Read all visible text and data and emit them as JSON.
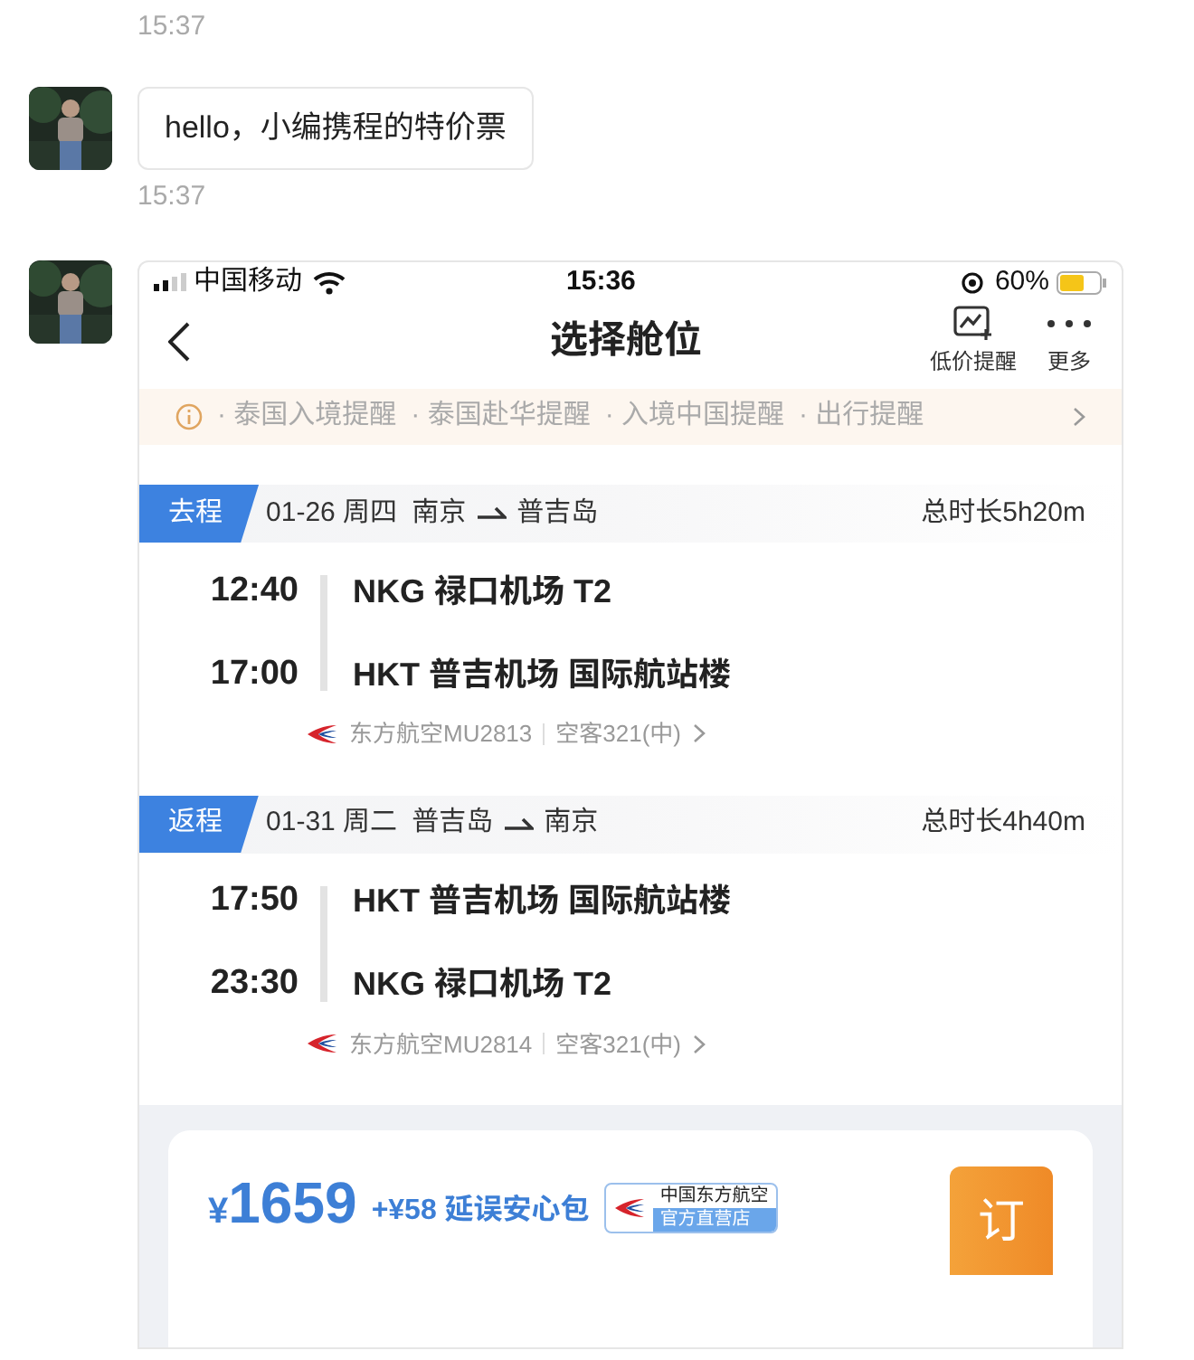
{
  "messages": [
    {
      "kind": "time",
      "text": "15:37"
    },
    {
      "kind": "text",
      "text": "hello，小编携程的特价票"
    },
    {
      "kind": "time",
      "text": "15:37"
    },
    {
      "kind": "screenshot"
    }
  ],
  "status_bar": {
    "carrier": "中国移动",
    "time": "15:36",
    "battery": "60%"
  },
  "nav": {
    "title": "选择舱位",
    "actions": [
      {
        "kind": "chart",
        "label": "低价提醒"
      },
      {
        "kind": "more",
        "label": "更多"
      }
    ]
  },
  "notices": [
    "· 泰国入境提醒",
    "· 泰国赴华提醒",
    "· 入境中国提醒",
    "· 出行提醒"
  ],
  "legs": [
    {
      "tag": "去程",
      "date": "01-26 周四",
      "from": "南京",
      "to": "普吉岛",
      "duration": "总时长5h20m",
      "stops": [
        {
          "time": "12:40",
          "airport": "NKG 禄口机场 T2"
        },
        {
          "time": "17:00",
          "airport": "HKT 普吉机场 国际航站楼"
        }
      ],
      "flight": "东方航空MU2813",
      "aircraft": "空客321(中)"
    },
    {
      "tag": "返程",
      "date": "01-31 周二",
      "from": "普吉岛",
      "to": "南京",
      "duration": "总时长4h40m",
      "stops": [
        {
          "time": "17:50",
          "airport": "HKT 普吉机场 国际航站楼"
        },
        {
          "time": "23:30",
          "airport": "NKG 禄口机场 T2"
        }
      ],
      "flight": "东方航空MU2814",
      "aircraft": "空客321(中)"
    }
  ],
  "offer": {
    "currency": "¥",
    "price": "1659",
    "addon": "+¥58 延误安心包",
    "badge_top": "中国东方航空",
    "badge_bottom": "官方直营店",
    "book": "订"
  }
}
